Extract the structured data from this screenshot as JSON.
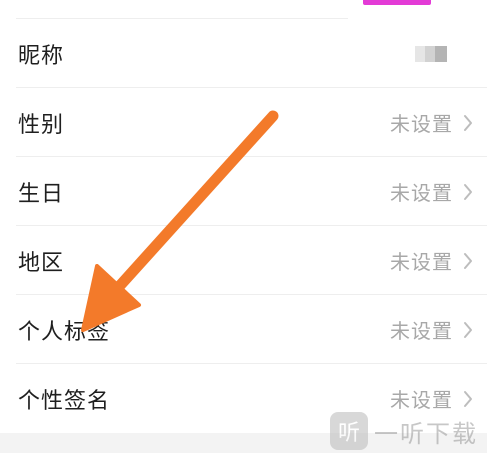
{
  "colors": {
    "accent": "#e33bd6",
    "arrow": "#f37a2a",
    "label": "#1f1f1f",
    "value": "#a8a8a8",
    "divider": "#eeeeee"
  },
  "settings": {
    "rows": [
      {
        "label": "昵称",
        "value": ""
      },
      {
        "label": "性别",
        "value": "未设置"
      },
      {
        "label": "生日",
        "value": "未设置"
      },
      {
        "label": "地区",
        "value": "未设置"
      },
      {
        "label": "个人标签",
        "value": "未设置"
      },
      {
        "label": "个性签名",
        "value": "未设置"
      }
    ],
    "chevron_icon": "chevron-right-icon"
  },
  "annotation": {
    "icon": "arrow-icon",
    "points_to": "个人标签"
  },
  "watermark": {
    "logo_char": "听",
    "text": "一听下载"
  }
}
